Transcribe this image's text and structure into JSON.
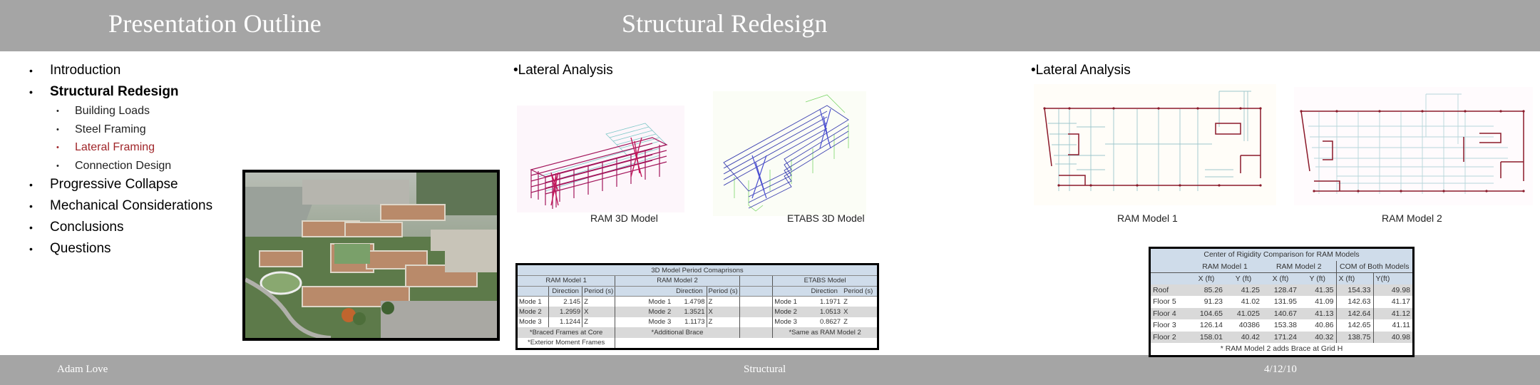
{
  "slides": [
    {
      "title": "Presentation Outline",
      "outline": [
        {
          "label": "Introduction",
          "level": 1
        },
        {
          "label": "Structural Redesign",
          "level": 1,
          "bold": true
        },
        {
          "label": "Building Loads",
          "level": 2
        },
        {
          "label": "Steel Framing",
          "level": 2
        },
        {
          "label": "Lateral Framing",
          "level": 2,
          "active": true
        },
        {
          "label": "Connection Design",
          "level": 2
        },
        {
          "label": "Progressive Collapse",
          "level": 1
        },
        {
          "label": "Mechanical Considerations",
          "level": 1
        },
        {
          "label": "Conclusions",
          "level": 1
        },
        {
          "label": "Questions",
          "level": 1
        }
      ],
      "bullet": "•",
      "photo_alt": "Aerial rendering of building campus"
    },
    {
      "title": "Structural Redesign",
      "heading": "•Lateral Analysis",
      "captions": [
        "RAM 3D Model",
        "ETABS 3D Model"
      ],
      "period_table": {
        "title": "3D Model Period Comaprisons",
        "groups": [
          "RAM Model 1",
          "RAM Model 2",
          "ETABS Model"
        ],
        "col_headers": [
          "Direction",
          "Period (s)"
        ],
        "rows": [
          {
            "mode": "Mode 1",
            "ram1": [
              "2.145",
              "Z"
            ],
            "ram2": [
              "1.4798",
              "Z"
            ],
            "etabs": [
              "1.1971",
              "Z"
            ]
          },
          {
            "mode": "Mode 2",
            "ram1": [
              "1.2959",
              "X"
            ],
            "ram2": [
              "1.3521",
              "X"
            ],
            "etabs": [
              "1.0513",
              "X"
            ]
          },
          {
            "mode": "Mode 3",
            "ram1": [
              "1.1244",
              "Z"
            ],
            "ram2": [
              "1.1173",
              "Z"
            ],
            "etabs": [
              "0.8627",
              "Z"
            ]
          }
        ],
        "notes": {
          "ram1": [
            "*Braced Frames at Core",
            "*Exterior Moment Frames"
          ],
          "ram2": "*Additional Brace",
          "etabs": "*Same as RAM Model 2"
        }
      }
    },
    {
      "heading": "•Lateral Analysis",
      "captions": [
        "RAM Model 1",
        "RAM Model 2"
      ],
      "rigidity_table": {
        "title": "Center of Rigidity Comparison for RAM Models",
        "groups": [
          "RAM Model 1",
          "RAM Model 2",
          "COM of Both Models"
        ],
        "col_headers": [
          "X (ft)",
          "Y (ft)",
          "X (ft)",
          "Y (ft)",
          "X (ft)",
          "Y(ft)"
        ],
        "rows": [
          {
            "level": "Roof",
            "values": [
              "85.26",
              "41.25",
              "128.47",
              "41.35",
              "154.33",
              "49.98"
            ]
          },
          {
            "level": "Floor 5",
            "values": [
              "91.23",
              "41.02",
              "131.95",
              "41.09",
              "142.63",
              "41.17"
            ]
          },
          {
            "level": "Floor 4",
            "values": [
              "104.65",
              "41.025",
              "140.67",
              "41.13",
              "142.64",
              "41.12"
            ]
          },
          {
            "level": "Floor 3",
            "values": [
              "126.14",
              "40386",
              "153.38",
              "40.86",
              "142.65",
              "41.11"
            ]
          },
          {
            "level": "Floor 2",
            "values": [
              "158.01",
              "40.42",
              "171.24",
              "40.32",
              "138.75",
              "40.98"
            ]
          }
        ],
        "note": "* RAM Model 2 adds Brace at Grid H"
      }
    }
  ],
  "footer": {
    "author": "Adam Love",
    "section": "Structural",
    "date": "4/12/10"
  },
  "colors": {
    "band": "#a5a5a5",
    "active": "#a0262a",
    "table_header": "#cfdcea",
    "row_gray": "#d9d9d9",
    "ram_frame": "#a3175c",
    "ram_beams": "#7fc8c8",
    "etabs_lines": "#3a3fb0",
    "etabs_cols": "#7dd66a",
    "plan_brace": "#8b1a2a"
  }
}
